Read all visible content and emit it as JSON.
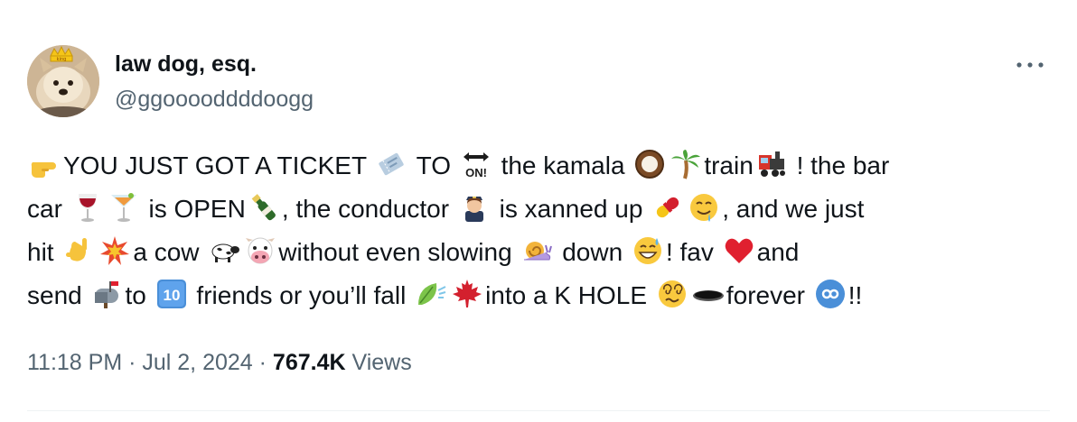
{
  "author": {
    "display_name": "law dog, esq.",
    "handle": "@ggooooddddoogg"
  },
  "tweet_lines": [
    [
      {
        "t": "e",
        "icon": "backhand-pointing-right-icon"
      },
      {
        "t": "s",
        "text": "YOU JUST GOT A TICKET "
      },
      {
        "t": "e",
        "icon": "ticket-icon"
      },
      {
        "t": "s",
        "text": " TO "
      },
      {
        "t": "e",
        "icon": "on-arrow-icon"
      },
      {
        "t": "s",
        "text": " the kamala "
      },
      {
        "t": "e",
        "icon": "coconut-icon"
      },
      {
        "t": "e",
        "icon": "palm-tree-icon"
      },
      {
        "t": "s",
        "text": "train"
      },
      {
        "t": "e",
        "icon": "locomotive-icon"
      },
      {
        "t": "s",
        "text": " ! the bar"
      }
    ],
    [
      {
        "t": "s",
        "text": "car "
      },
      {
        "t": "e",
        "icon": "wine-glass-icon"
      },
      {
        "t": "e",
        "icon": "cocktail-glass-icon"
      },
      {
        "t": "s",
        "text": " is OPEN"
      },
      {
        "t": "e",
        "icon": "champagne-bottle-icon"
      },
      {
        "t": "s",
        "text": ", the conductor "
      },
      {
        "t": "e",
        "icon": "pilot-icon"
      },
      {
        "t": "s",
        "text": " is xanned up "
      },
      {
        "t": "e",
        "icon": "pill-icon"
      },
      {
        "t": "e",
        "icon": "drooling-face-icon"
      },
      {
        "t": "s",
        "text": ", and we just"
      }
    ],
    [
      {
        "t": "s",
        "text": "hit "
      },
      {
        "t": "e",
        "icon": "call-me-hand-icon"
      },
      {
        "t": "e",
        "icon": "collision-icon"
      },
      {
        "t": "s",
        "text": "a cow "
      },
      {
        "t": "e",
        "icon": "cow-icon"
      },
      {
        "t": "e",
        "icon": "cow-face-icon"
      },
      {
        "t": "s",
        "text": "without even slowing "
      },
      {
        "t": "e",
        "icon": "snail-icon"
      },
      {
        "t": "s",
        "text": " down "
      },
      {
        "t": "e",
        "icon": "grinning-sweat-face-icon"
      },
      {
        "t": "s",
        "text": "! fav "
      },
      {
        "t": "e",
        "icon": "red-heart-icon"
      },
      {
        "t": "s",
        "text": "and"
      }
    ],
    [
      {
        "t": "s",
        "text": "send "
      },
      {
        "t": "e",
        "icon": "mailbox-icon"
      },
      {
        "t": "s",
        "text": "to "
      },
      {
        "t": "e",
        "icon": "keycap-ten-icon"
      },
      {
        "t": "s",
        "text": " friends or you’ll fall "
      },
      {
        "t": "e",
        "icon": "leaf-fluttering-icon"
      },
      {
        "t": "e",
        "icon": "maple-leaf-icon"
      },
      {
        "t": "s",
        "text": "into a K HOLE "
      },
      {
        "t": "e",
        "icon": "dizzy-face-icon"
      },
      {
        "t": "e",
        "icon": "hole-icon"
      },
      {
        "t": "s",
        "text": "forever "
      },
      {
        "t": "e",
        "icon": "infinity-icon"
      },
      {
        "t": "s",
        "text": "!!"
      }
    ]
  ],
  "meta": {
    "time": "11:18 PM",
    "separator1": " · ",
    "date": "Jul 2, 2024",
    "separator2": " · ",
    "views_count": "767.4K",
    "views_label": " Views"
  },
  "colors": {
    "text": "#0f1419",
    "secondary": "#536471",
    "divider": "#eff3f4"
  }
}
